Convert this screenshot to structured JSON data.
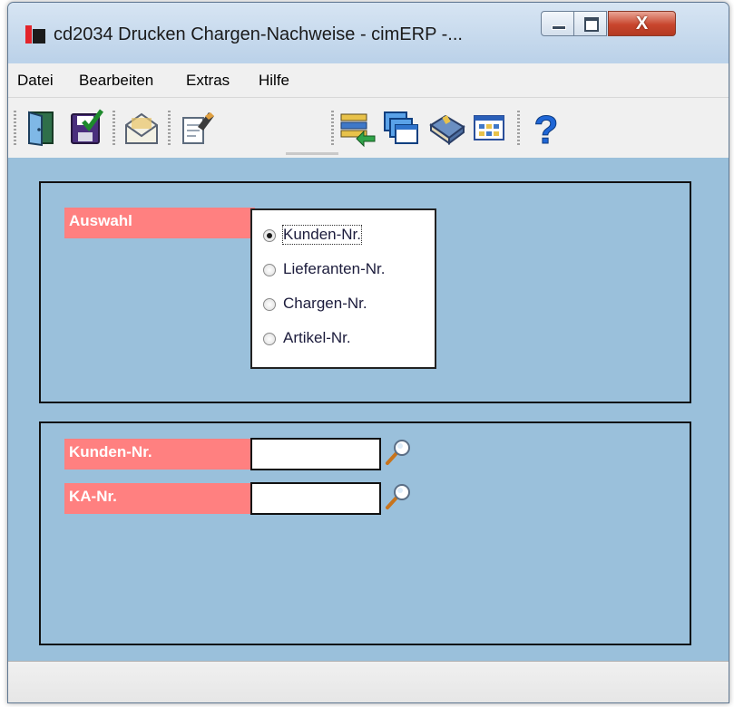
{
  "window": {
    "title": "cd2034 Drucken Chargen-Nachweise - cimERP -...",
    "minimize_icon": "minimize-icon",
    "maximize_icon": "maximize-icon",
    "close_label": "X",
    "accent_color": "#c8452d"
  },
  "menu": {
    "items": [
      {
        "label": "Datei"
      },
      {
        "label": "Bearbeiten"
      },
      {
        "label": "Extras"
      },
      {
        "label": "Hilfe"
      }
    ]
  },
  "toolbar": {
    "buttons": [
      {
        "icon": "exit-door-icon"
      },
      {
        "icon": "save-icon"
      },
      {
        "icon": "mail-icon"
      },
      {
        "icon": "edit-document-icon"
      },
      {
        "icon": "list-import-icon"
      },
      {
        "icon": "windows-cascade-icon"
      },
      {
        "icon": "book-icon"
      },
      {
        "icon": "grid-view-icon"
      },
      {
        "icon": "help-icon",
        "glyph": "?"
      }
    ]
  },
  "auswahl": {
    "label": "Auswahl",
    "options": [
      {
        "label": "Kunden-Nr.",
        "selected": true
      },
      {
        "label": "Lieferanten-Nr.",
        "selected": false
      },
      {
        "label": "Chargen-Nr.",
        "selected": false
      },
      {
        "label": "Artikel-Nr.",
        "selected": false
      }
    ]
  },
  "fields": [
    {
      "label": "Kunden-Nr.",
      "value": "",
      "search_icon": "magnifier-icon"
    },
    {
      "label": "KA-Nr.",
      "value": "",
      "search_icon": "magnifier-icon"
    }
  ],
  "colors": {
    "client_background": "#9ac0db",
    "label_background": "#ff8080",
    "label_text": "#ffffff"
  },
  "statusbar": {
    "text": ""
  }
}
